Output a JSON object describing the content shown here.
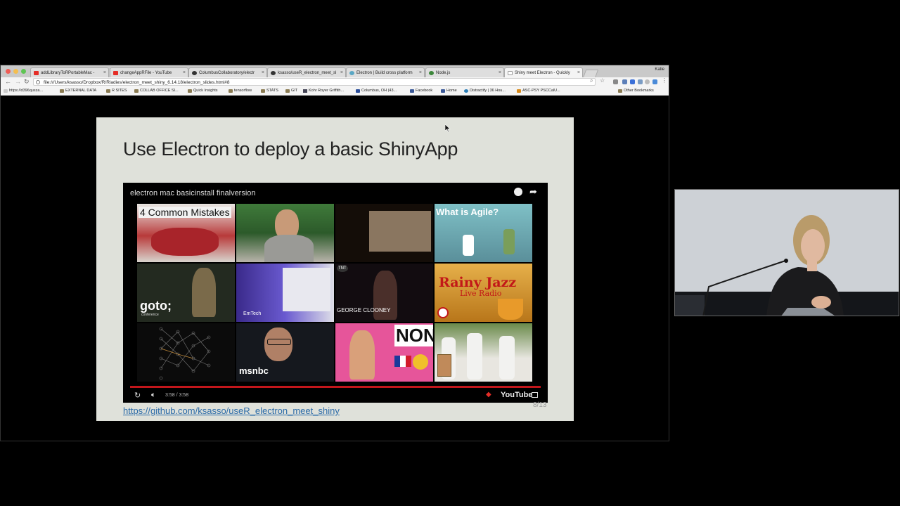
{
  "browser": {
    "tabs": [
      {
        "label": "addLibraryToRPortableMac -",
        "favicon": "youtube-icon",
        "color": "#e52d27"
      },
      {
        "label": "changeAppRFile - YouTube",
        "favicon": "youtube-icon",
        "color": "#e52d27"
      },
      {
        "label": "ColumbusCollaboratory/electr",
        "favicon": "github-icon",
        "color": "#333333"
      },
      {
        "label": "ksasso/useR_electron_meet_sl",
        "favicon": "github-icon",
        "color": "#333333"
      },
      {
        "label": "Electron | Build cross platform",
        "favicon": "electron-icon",
        "color": "#5aa7c4"
      },
      {
        "label": "Node.js",
        "favicon": "nodejs-icon",
        "color": "#3c873a"
      },
      {
        "label": "Shiny meet Electron - Quickly",
        "favicon": "page-icon",
        "color": "#9a9a9a",
        "active": true
      }
    ],
    "profile": "Katie",
    "url": "file:///Users/ksasso/Dropbox/R/Rladies/electron_meet_shiny_6.14.18/electron_slides.html#8",
    "bookmarks": [
      "https://d396qusza...",
      "EXTERNAL DATA",
      "R SITES",
      "COLLAB OFFICE SI...",
      "Quick Insights",
      "tensorflow",
      "STATS",
      "GIT",
      "Kohr Royer Griffith...",
      "Columbus, OH (43...",
      "Facebook",
      "Home",
      "Distractify | 36 Hou...",
      "ASC-PSY PSCCalU...",
      "Other Bookmarks"
    ]
  },
  "slide": {
    "title": "Use Electron to deploy a basic ShinyApp",
    "link": "https://github.com/ksasso/useR_electron_meet_shiny",
    "page": "8/13"
  },
  "video": {
    "title": "electron mac basicinstall finalversion",
    "time": "3:58 / 3:58",
    "brand": "YouTube",
    "thumbnails": [
      {
        "caption": "4 Common Mistakes"
      },
      {
        "caption": ""
      },
      {
        "caption": ""
      },
      {
        "caption": "What is Agile?"
      },
      {
        "caption": "goto;"
      },
      {
        "caption": "EmTech"
      },
      {
        "caption": "GEORGE CLOONEY"
      },
      {
        "caption": "Rainy Jazz"
      },
      {
        "caption": ""
      },
      {
        "caption": "msnbc"
      },
      {
        "caption": "NON."
      },
      {
        "caption": ""
      }
    ],
    "thumb_subcaptions": {
      "goto": "conference",
      "jazz": "Live Radio",
      "tnt": "TNT"
    }
  },
  "colors": {
    "slide_bg": "#dfe1da",
    "link": "#2a6aa8",
    "progress": "#c2161b",
    "youtube_red": "#e52d27"
  }
}
